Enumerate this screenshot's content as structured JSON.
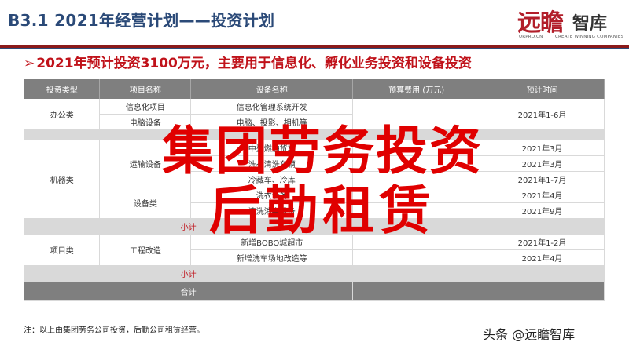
{
  "header": {
    "title": "B3.1  2021年经营计划——投资计划",
    "logo": {
      "main": "远瞻",
      "sub": "智库",
      "url": "URPRO.CN",
      "tagline": "CREATE WINNING COMPANIES"
    }
  },
  "subtitle": {
    "arrow": "➢",
    "text": "2021年预计投资3100万元，主要用于信息化、孵化业务投资和设备投资"
  },
  "table": {
    "headers": [
      "投资类型",
      "项目名称",
      "设备名称",
      "预算费用 (万元)",
      "预计时间"
    ],
    "office": {
      "type": "办公类",
      "rows": [
        {
          "project": "信息化项目",
          "device": "信息化管理系统开发",
          "time": "2021年1-6月"
        },
        {
          "project": "电脑设备",
          "device": "电脑、投影、相机等"
        }
      ]
    },
    "machine": {
      "type": "机器类",
      "transport_project": "运输设备",
      "equipment_project": "设备类",
      "rows": [
        {
          "device": "中型燃油货车",
          "time": "2021年3月"
        },
        {
          "device": "洗衣清洗车辆",
          "time": "2021年3月"
        },
        {
          "device": "冷藏车、冷库",
          "time": "2021年1-7月"
        },
        {
          "device": "洗衣设备",
          "time": "2021年4月"
        },
        {
          "device": "清洗消毒设备",
          "time": "2021年9月"
        }
      ],
      "subtotal": "小计"
    },
    "project_type": {
      "type": "项目类",
      "project": "工程改造",
      "rows": [
        {
          "device": "新增BOBO城超市",
          "time": "2021年1-2月"
        },
        {
          "device": "新增洗车场地改造等",
          "time": "2021年4月"
        }
      ],
      "subtotal": "小计"
    },
    "total": "合计"
  },
  "overlay": {
    "line1": "集团劳务投资",
    "line2": "后勤租赁"
  },
  "note": "注：以上由集团劳务公司投资，后勤公司租赁经营。",
  "watermark": "头条 @远瞻智库",
  "colors": {
    "title": "#2b4a78",
    "accent": "#c0121a",
    "header_bg": "#7f7f7f",
    "subtotal_bg": "#d9d9d9",
    "overlay": "#e00000"
  }
}
